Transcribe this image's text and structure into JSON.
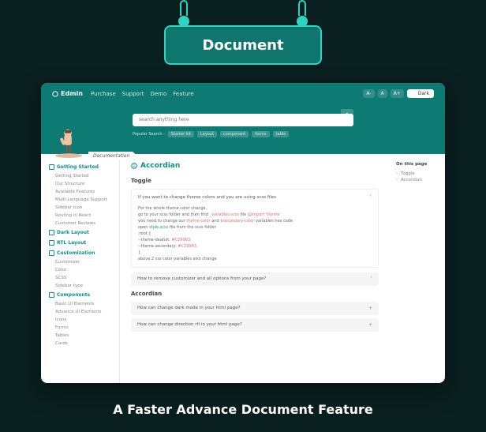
{
  "badge": "Document",
  "header": {
    "logo": "Edmin",
    "nav": [
      "Purchase",
      "Support",
      "Demo",
      "Feature"
    ],
    "fontbtns": [
      "A-",
      "A",
      "A+"
    ],
    "darkbtn": "Dark",
    "search_placeholder": "search anything here",
    "popular_label": "Popular Search :",
    "popular_tags": [
      "Starter kit",
      "Layout",
      "component",
      "forms",
      "table"
    ],
    "flag": "Documentation"
  },
  "sidebar": {
    "groups": [
      {
        "title": "Getting Started",
        "items": [
          "Getting Started",
          "Our Structure",
          "Available Features",
          "Multi-Language Support",
          "Sidebar icon",
          "Routing in React",
          "Customer Reviews"
        ]
      },
      {
        "title": "Dark Layout",
        "items": []
      },
      {
        "title": "RTL Layout",
        "items": []
      },
      {
        "title": "Customization",
        "items": [
          "Customizer",
          "Color",
          "SCSS",
          "Sidebar type"
        ]
      },
      {
        "title": "Components",
        "items": [
          "Basic UI Elements",
          "Advance UI Elements",
          "Icons",
          "Forms",
          "Tables",
          "Cards"
        ]
      }
    ]
  },
  "main": {
    "title": "Accordian",
    "sec1": "Toggle",
    "acc_open_title": "If you want to change theme colors and you are using scss files",
    "acc_open_body": {
      "l1": "For the whole theme color change,",
      "l2a": "go to your scss folder and then find ",
      "l2b": "_variables.scss",
      "l2c": " file ",
      "l2d": "@import 'theme'",
      "l3a": "you need to change our ",
      "l3b": "theme-color",
      "l3c": " and ",
      "l3d": "$secondary-color",
      "l3e": " variables hex code",
      "l4a": "open ",
      "l4b": "style.scss",
      "l4c": " file from the scss folder",
      "l5": ":root {",
      "l6a": "--theme-deafult: ",
      "l6b": "#C29963;",
      "l7a": "--theme-secondary: ",
      "l7b": "#C29963;",
      "l8": "}",
      "l9": "above 2 css color variables also change"
    },
    "acc2": "How to remove customizer and all options from your page?",
    "sec2": "Accordian",
    "acc3": "How can change dark mode in your html page?",
    "acc4": "How can change direction rtl in your html page?"
  },
  "right": {
    "title": "On this page",
    "items": [
      "Toggle",
      "Accordian"
    ]
  },
  "footer": "A Faster Advance Document Feature"
}
